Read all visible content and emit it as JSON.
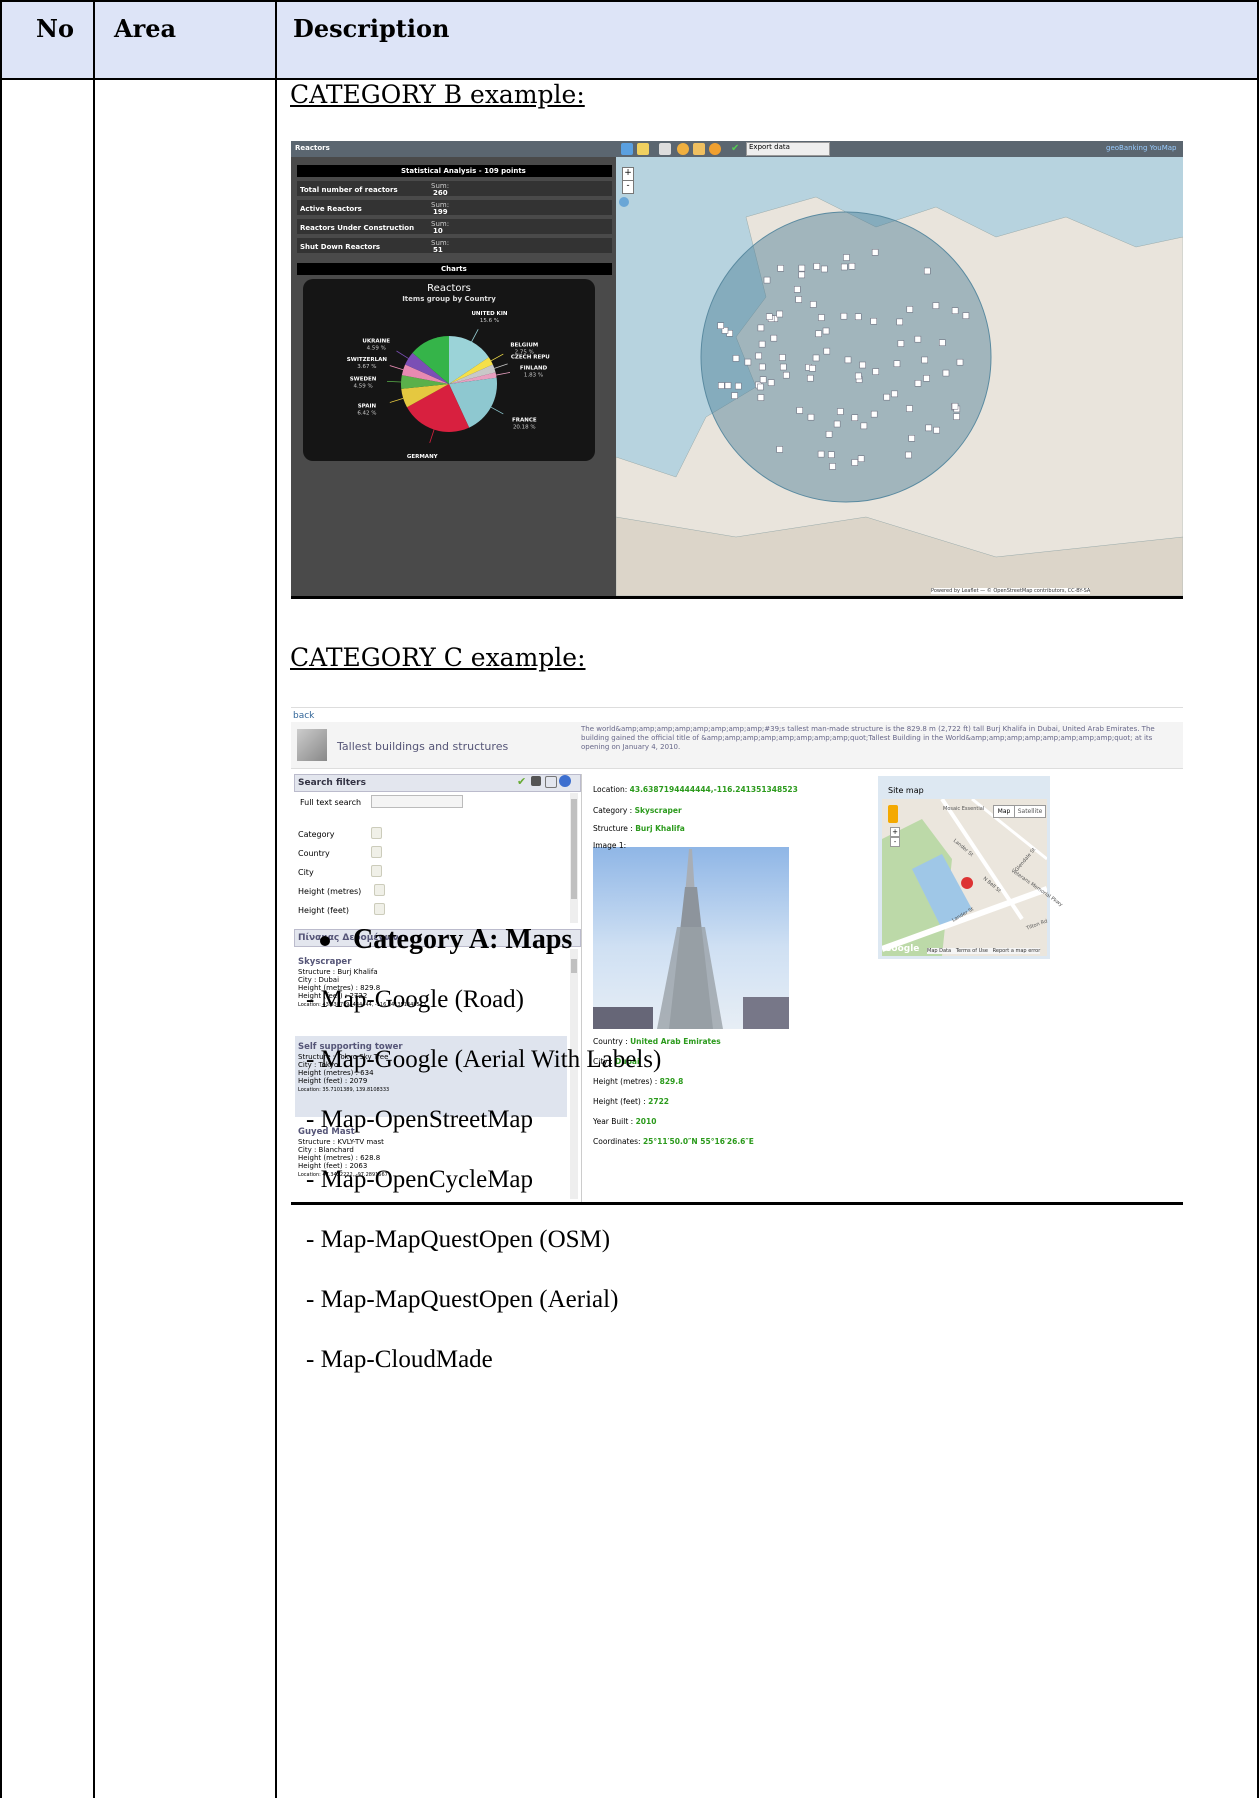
{
  "table": {
    "headers": {
      "no": "No",
      "area": "Area",
      "description": "Description"
    }
  },
  "categoryB": {
    "title": "CATEGORY B example:",
    "app_title": "Reactors",
    "export_select": "Export data",
    "brand": "geoBanking YouMap",
    "stats_title": "Statistical Analysis - 109 points",
    "rows": [
      {
        "label": "Total number of reactors",
        "sum_label": "Sum:",
        "value": "260"
      },
      {
        "label": "Active Reactors",
        "sum_label": "Sum:",
        "value": "199"
      },
      {
        "label": "Reactors Under Construction",
        "sum_label": "Sum:",
        "value": "10"
      },
      {
        "label": "Shut Down Reactors",
        "sum_label": "Sum:",
        "value": "51"
      }
    ],
    "charts_title": "Charts",
    "pie_title": "Reactors",
    "pie_subtitle": "Items group by Country",
    "attribution": "Powered by Leaflet — © OpenStreetMap contributors, CC-BY-SA"
  },
  "chart_data": {
    "type": "pie",
    "title": "Reactors",
    "subtitle": "Items group by Country",
    "slices": [
      {
        "label": "UNITED KIN",
        "value": 15.6,
        "display": "15.6 %",
        "color": "#9bd3d8"
      },
      {
        "label": "BELGIUM",
        "value": 2.75,
        "display": "2.75 %",
        "color": "#f5e049"
      },
      {
        "label": "CZECH REPU",
        "value": 2.75,
        "display": "",
        "color": "#c8c8c8"
      },
      {
        "label": "FINLAND",
        "value": 1.83,
        "display": "1.83 %",
        "color": "#e8a0c0"
      },
      {
        "label": "FRANCE",
        "value": 20.18,
        "display": "20.18 %",
        "color": "#8ec8d0"
      },
      {
        "label": "GERMANY",
        "value": 23.85,
        "display": "23.85 %",
        "color": "#d8203f"
      },
      {
        "label": "SPAIN",
        "value": 6.42,
        "display": "6.42 %",
        "color": "#e5c840"
      },
      {
        "label": "SWEDEN",
        "value": 4.59,
        "display": "4.59 %",
        "color": "#5ab04a"
      },
      {
        "label": "SWITZERLAN",
        "value": 3.67,
        "display": "3.67 %",
        "color": "#e78ab2"
      },
      {
        "label": "UKRAINE",
        "value": 4.59,
        "display": "4.59 %",
        "color": "#7b4fb5"
      },
      {
        "label": "",
        "value": 13.77,
        "display": "",
        "color": "#35b449"
      }
    ]
  },
  "categoryC": {
    "title": "CATEGORY C example:",
    "back": "back",
    "page_title": "Tallest buildings and structures",
    "description": "The world&amp;amp;amp;amp;amp;amp;amp;amp;#39;s tallest man-made structure is the 829.8 m (2,722 ft) tall Burj Khalifa in Dubai, United Arab Emirates. The building gained the official title of &amp;amp;amp;amp;amp;amp;amp;amp;quot;Tallest Building in the World&amp;amp;amp;amp;amp;amp;amp;amp;quot; at its opening on January 4, 2010.",
    "search_filters": "Search filters",
    "filters": [
      "Full text search",
      "Category",
      "Country",
      "City",
      "Height (metres)",
      "Height (feet)"
    ],
    "data_table_title": "Πίνακας Δεδομένων",
    "records": [
      {
        "title": "Skyscraper",
        "lines": [
          "Structure : Burj Khalifa",
          "City : Dubai",
          "Height (metres) : 829.8",
          "Height (feet) : 2722"
        ],
        "location": "Location: 43.6387194444444, -116.241351348523"
      },
      {
        "title": "Self supporting tower",
        "lines": [
          "Structure : Tokyo Sky Tree",
          "City : Tokyo",
          "Height (metres) : 634",
          "Height (feet) : 2079"
        ],
        "location": "Location: 35.7101389, 139.8108333"
      },
      {
        "title": "Guyed Mast",
        "lines": [
          "Structure : KVLY-TV mast",
          "City : Blanchard",
          "Height (metres) : 628.8",
          "Height (feet) : 2063"
        ],
        "location": "Location: 47.3422222, -97.2891667"
      }
    ],
    "detail": {
      "location_label": "Location:",
      "location_value": "43.6387194444444,-116.241351348523",
      "category_label": "Category :",
      "category_value": "Skyscraper",
      "structure_label": "Structure :",
      "structure_value": "Burj Khalifa",
      "image_label": "Image 1:",
      "country_label": "Country :",
      "country_value": "United Arab Emirates",
      "city_label": "City :",
      "city_value": "Dubai",
      "hm_label": "Height (metres) :",
      "hm_value": "829.8",
      "hf_label": "Height (feet) :",
      "hf_value": "2722",
      "year_label": "Year Built :",
      "year_value": "2010",
      "coord_label": "Coordinates:",
      "coord_value": "25°11′50.0″N 55°16′26.6″E"
    },
    "site_map": {
      "title": "Site map",
      "map_btn": "Map",
      "satellite_btn": "Satellite",
      "poi": "Mosaic Essential",
      "footer": "Map Data   Terms of Use   Report a map error",
      "logo": "Google",
      "streets": [
        "Lander St",
        "N Bell St",
        "Glendale St",
        "Veterans Memorial Pkwy",
        "Lander St",
        "Tilton Rd"
      ]
    }
  },
  "categoryA": {
    "heading": "Category A: Maps",
    "items": [
      "- Map-Google (Road)",
      "- Map-Google (Aerial With Labels)",
      "- Map-OpenStreetMap",
      "- Map-OpenCycleMap",
      "- Map-MapQuestOpen (OSM)",
      "- Map-MapQuestOpen (Aerial)",
      "- Map-CloudMade"
    ]
  }
}
